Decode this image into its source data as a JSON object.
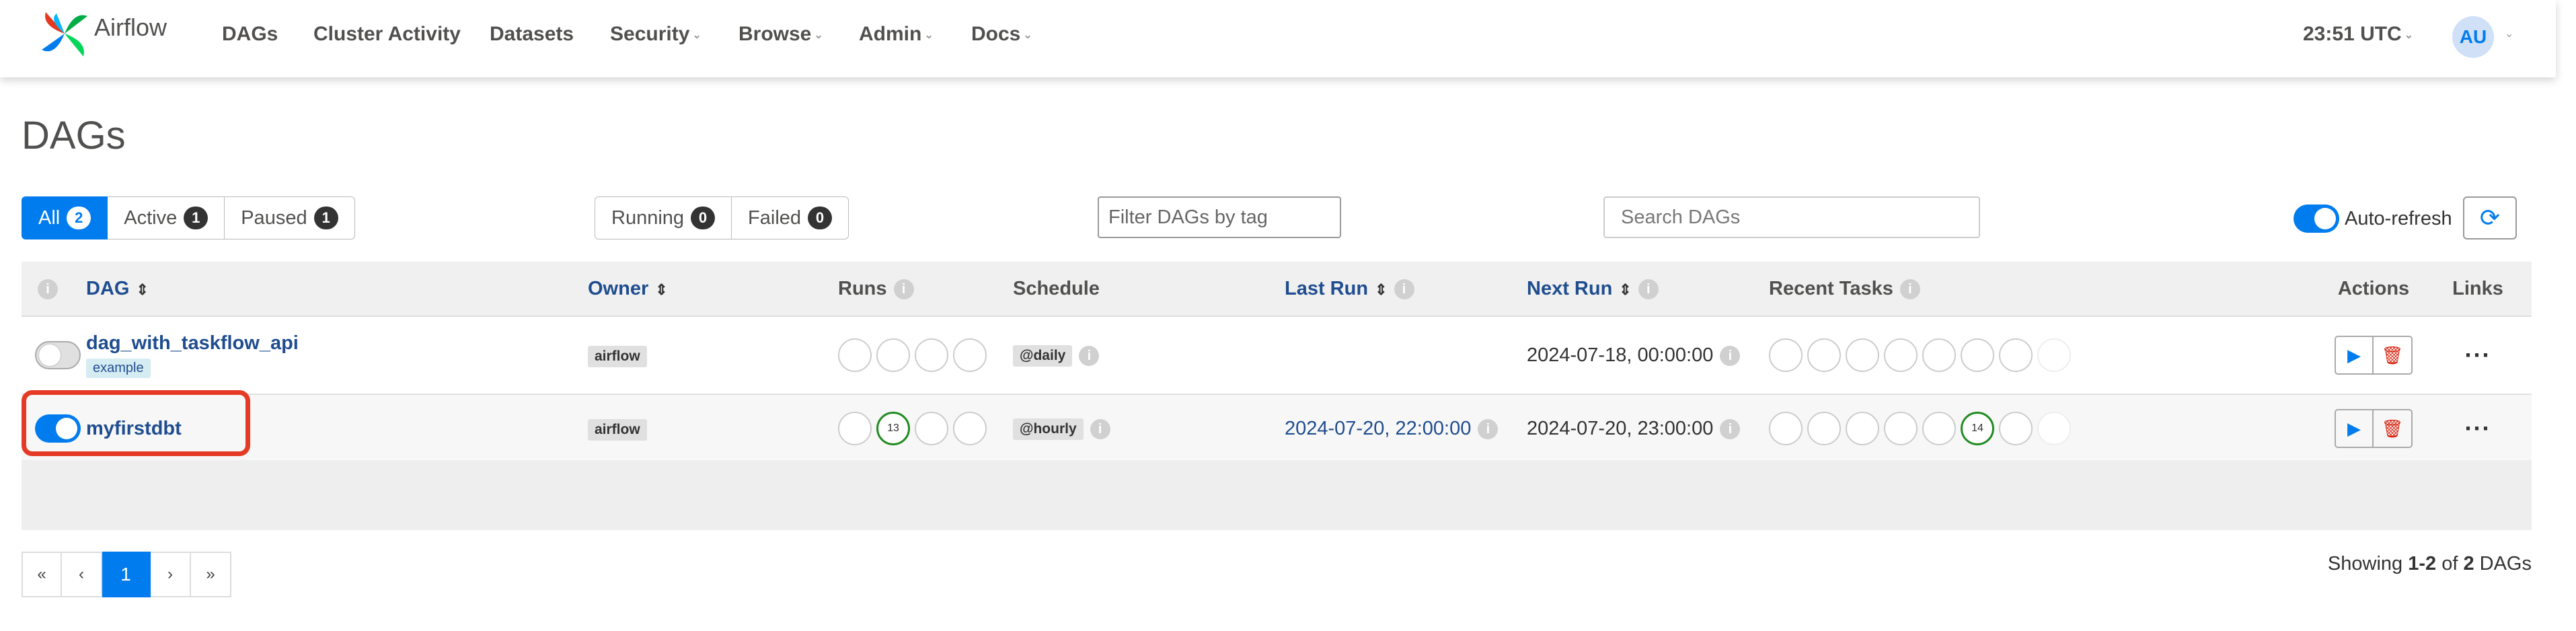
{
  "brand": {
    "name": "Airflow"
  },
  "nav": {
    "items": [
      "DAGs",
      "Cluster Activity",
      "Datasets",
      "Security",
      "Browse",
      "Admin",
      "Docs"
    ],
    "time": "23:51 UTC",
    "avatar": "AU"
  },
  "page_title": "DAGs",
  "filters": {
    "all": {
      "label": "All",
      "count": "2"
    },
    "active": {
      "label": "Active",
      "count": "1"
    },
    "paused": {
      "label": "Paused",
      "count": "1"
    },
    "running": {
      "label": "Running",
      "count": "0"
    },
    "failed": {
      "label": "Failed",
      "count": "0"
    },
    "tag_placeholder": "Filter DAGs by tag",
    "search_placeholder": "Search DAGs",
    "autorefresh_label": "Auto-refresh",
    "autorefresh_on": true
  },
  "table": {
    "columns": {
      "dag": "DAG",
      "owner": "Owner",
      "runs": "Runs",
      "schedule": "Schedule",
      "last_run": "Last Run",
      "next_run": "Next Run",
      "recent_tasks": "Recent Tasks",
      "actions": "Actions",
      "links": "Links"
    },
    "rows": [
      {
        "dag_id": "dag_with_taskflow_api",
        "tag": "example",
        "paused": true,
        "owner": "airflow",
        "runs_success_count": "",
        "schedule": "@daily",
        "last_run": "",
        "next_run": "2024-07-18, 00:00:00",
        "recent_success_count": ""
      },
      {
        "dag_id": "myfirstdbt",
        "tag": "",
        "paused": false,
        "owner": "airflow",
        "runs_success_count": "13",
        "schedule": "@hourly",
        "last_run": "2024-07-20, 22:00:00",
        "next_run": "2024-07-20, 23:00:00",
        "recent_success_count": "14"
      }
    ]
  },
  "pagination": {
    "first": "«",
    "prev": "‹",
    "current": "1",
    "next": "›",
    "last": "»"
  },
  "showing": {
    "prefix": "Showing ",
    "range": "1-2",
    "of": " of ",
    "total": "2",
    "suffix": " DAGs"
  },
  "colors": {
    "primary": "#017cee",
    "success": "#228b22",
    "danger": "#d9230f",
    "highlight": "#e53a25"
  },
  "icons": {
    "info": "info-icon",
    "sort": "sort-icon",
    "play": "play-icon",
    "delete": "trash-icon",
    "refresh": "refresh-icon",
    "more": "more-icon"
  }
}
